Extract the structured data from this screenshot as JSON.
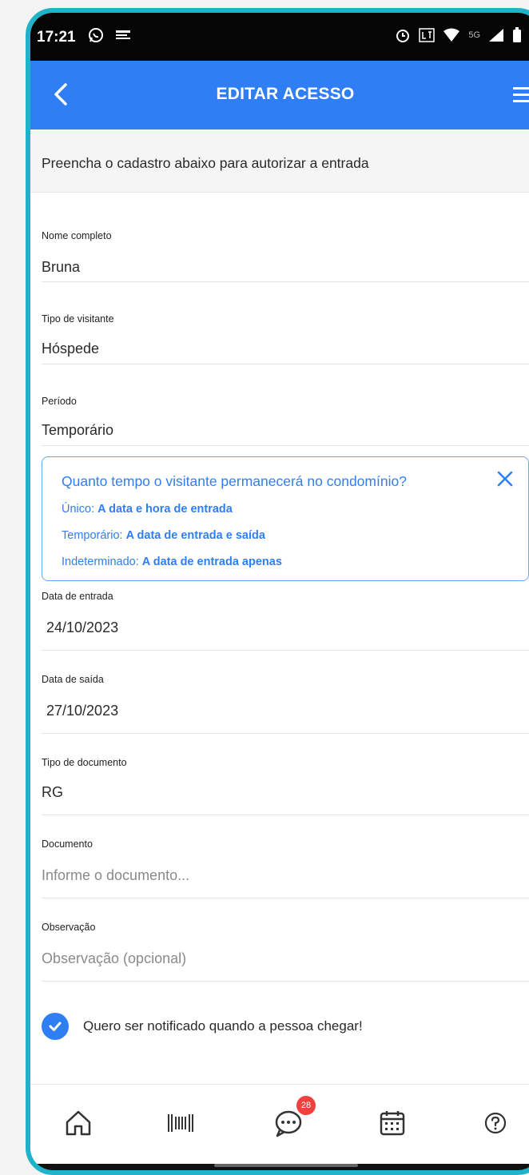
{
  "status_bar": {
    "time": "17:21",
    "network": "5G",
    "battery": "64"
  },
  "app_bar": {
    "title": "EDITAR ACESSO"
  },
  "intro_text": "Preencha o cadastro abaixo para autorizar a entrada",
  "fields": [
    {
      "label": "Nome completo",
      "value": "Bruna"
    },
    {
      "label": "Tipo de visitante",
      "value": "Hóspede"
    },
    {
      "label": "Período",
      "value": "Temporário"
    }
  ],
  "info_box": {
    "question": "Quanto tempo o visitante permanecerá no condomínio?",
    "lines": [
      {
        "key": "Único:",
        "text": "A data e hora de entrada"
      },
      {
        "key": "Temporário:",
        "text": "A data de entrada e saída"
      },
      {
        "key": "Indeterminado:",
        "text": "A data de entrada apenas"
      }
    ]
  },
  "fields_2": [
    {
      "label": "Data de entrada",
      "value": "24/10/2023"
    },
    {
      "label": "Data de saída",
      "value": "27/10/2023"
    },
    {
      "label": "Tipo de documento",
      "value": "RG"
    }
  ],
  "document": {
    "label": "Documento",
    "placeholder": "Informe o documento..."
  },
  "observation": {
    "label": "Observação",
    "placeholder": "Observação (opcional)"
  },
  "notify": {
    "label": "Quero ser notificado quando a pessoa chegar!",
    "checked": true
  },
  "bottom_nav": {
    "items": [
      "home-icon",
      "barcode-icon",
      "chat-icon",
      "calendar-icon",
      "help-icon"
    ],
    "chat_badge": "28"
  },
  "colors": {
    "primary": "#2f7ef3",
    "frame": "#1fb3c9",
    "badge": "#f0413f"
  }
}
